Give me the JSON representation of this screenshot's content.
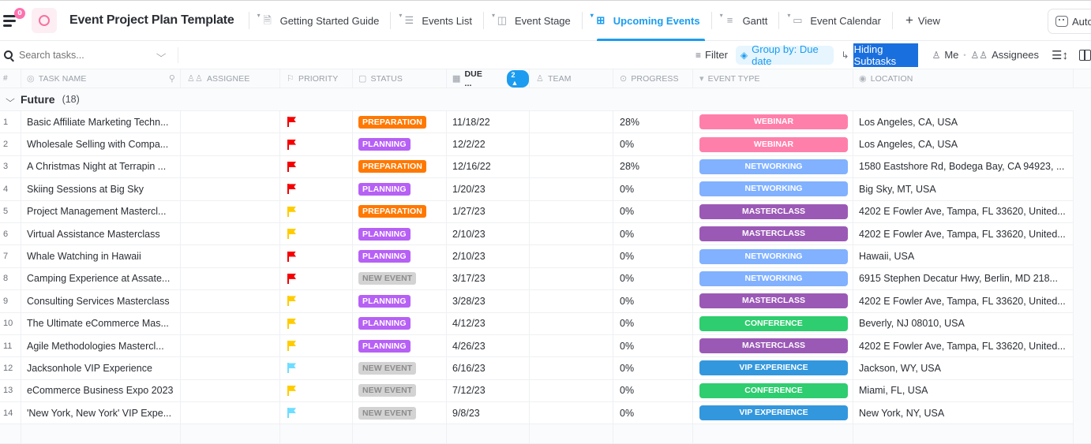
{
  "header": {
    "notification_count": "0",
    "title": "Event Project Plan Template",
    "tabs": [
      {
        "label": "Getting Started Guide",
        "icon": "doc-icon",
        "glyph": "🗎",
        "active": false
      },
      {
        "label": "Events List",
        "icon": "list-icon",
        "glyph": "☰",
        "active": false
      },
      {
        "label": "Event Stage",
        "icon": "board-icon",
        "glyph": "◫",
        "active": false
      },
      {
        "label": "Upcoming Events",
        "icon": "table-icon",
        "glyph": "⊞",
        "active": true
      },
      {
        "label": "Gantt",
        "icon": "gantt-icon",
        "glyph": "≡",
        "active": false
      },
      {
        "label": "Event Calendar",
        "icon": "calendar-icon",
        "glyph": "▭",
        "active": false
      }
    ],
    "add_view_label": "View",
    "automations_label": "Auto"
  },
  "toolbar": {
    "search_placeholder": "Search tasks...",
    "filter_label": "Filter",
    "group_by_label": "Group by: Due date",
    "subtasks_label": "Hiding Subtasks",
    "me_label": "Me",
    "assignees_label": "Assignees"
  },
  "columns": {
    "num": "#",
    "name": "TASK NAME",
    "assignee": "ASSIGNEE",
    "priority": "PRIORITY",
    "status": "STATUS",
    "due": "DUE ...",
    "due_sort_badge": "2 ▲",
    "team": "TEAM",
    "progress": "PROGRESS",
    "event_type": "EVENT TYPE",
    "location": "LOCATION"
  },
  "group": {
    "name": "Future",
    "count": "(18)"
  },
  "colors": {
    "priority": {
      "urgent": "#f50000",
      "high": "#ffcc00",
      "normal": "#6fddff"
    },
    "status": {
      "PREPARATION": "#ff7800",
      "PLANNING": "#b660f5",
      "NEW EVENT": "#d3d3d3"
    },
    "status_text": {
      "PREPARATION": "#ffffff",
      "PLANNING": "#ffffff",
      "NEW EVENT": "#8c8c8c"
    },
    "event_type": {
      "WEBINAR": "#ff7fab",
      "NETWORKING": "#81b1ff",
      "MASTERCLASS": "#9b59b6",
      "CONFERENCE": "#2ecd6f",
      "VIP EXPERIENCE": "#3397dd"
    },
    "accent": "#1b9cf0"
  },
  "rows": [
    {
      "num": "1",
      "name": "Basic Affiliate Marketing Techn...",
      "priority": "urgent",
      "status": "PREPARATION",
      "due": "11/18/22",
      "progress": "28%",
      "event_type": "WEBINAR",
      "location": "Los Angeles, CA, USA"
    },
    {
      "num": "2",
      "name": "Wholesale Selling with Compa...",
      "priority": "urgent",
      "status": "PLANNING",
      "due": "12/2/22",
      "progress": "0%",
      "event_type": "WEBINAR",
      "location": "Los Angeles, CA, USA"
    },
    {
      "num": "3",
      "name": "A Christmas Night at Terrapin ...",
      "priority": "urgent",
      "status": "PREPARATION",
      "due": "12/16/22",
      "progress": "28%",
      "event_type": "NETWORKING",
      "location": "1580 Eastshore Rd, Bodega Bay, CA 94923, ..."
    },
    {
      "num": "4",
      "name": "Skiing Sessions at Big Sky",
      "priority": "urgent",
      "status": "PLANNING",
      "due": "1/20/23",
      "progress": "0%",
      "event_type": "NETWORKING",
      "location": "Big Sky, MT, USA"
    },
    {
      "num": "5",
      "name": "Project Management Mastercl...",
      "priority": "high",
      "status": "PREPARATION",
      "due": "1/27/23",
      "progress": "0%",
      "event_type": "MASTERCLASS",
      "location": "4202 E Fowler Ave, Tampa, FL 33620, United..."
    },
    {
      "num": "6",
      "name": "Virtual Assistance Masterclass",
      "priority": "high",
      "status": "PLANNING",
      "due": "2/10/23",
      "progress": "0%",
      "event_type": "MASTERCLASS",
      "location": "4202 E Fowler Ave, Tampa, FL 33620, United..."
    },
    {
      "num": "7",
      "name": "Whale Watching in Hawaii",
      "priority": "urgent",
      "status": "PLANNING",
      "due": "2/10/23",
      "progress": "0%",
      "event_type": "NETWORKING",
      "location": "Hawaii, USA"
    },
    {
      "num": "8",
      "name": "Camping Experience at Assate...",
      "priority": "urgent",
      "status": "NEW EVENT",
      "due": "3/17/23",
      "progress": "0%",
      "event_type": "NETWORKING",
      "location": "6915 Stephen Decatur Hwy, Berlin, MD 218..."
    },
    {
      "num": "9",
      "name": "Consulting Services Masterclass",
      "priority": "high",
      "status": "PLANNING",
      "due": "3/28/23",
      "progress": "0%",
      "event_type": "MASTERCLASS",
      "location": "4202 E Fowler Ave, Tampa, FL 33620, United..."
    },
    {
      "num": "10",
      "name": "The Ultimate eCommerce Mas...",
      "priority": "high",
      "status": "PLANNING",
      "due": "4/12/23",
      "progress": "0%",
      "event_type": "CONFERENCE",
      "location": "Beverly, NJ 08010, USA"
    },
    {
      "num": "11",
      "name": "Agile Methodologies Mastercl...",
      "priority": "high",
      "status": "PLANNING",
      "due": "4/26/23",
      "progress": "0%",
      "event_type": "MASTERCLASS",
      "location": "4202 E Fowler Ave, Tampa, FL 33620, United..."
    },
    {
      "num": "12",
      "name": "Jacksonhole VIP Experience",
      "priority": "normal",
      "status": "NEW EVENT",
      "due": "6/16/23",
      "progress": "0%",
      "event_type": "VIP EXPERIENCE",
      "location": "Jackson, WY, USA"
    },
    {
      "num": "13",
      "name": "eCommerce Business Expo 2023",
      "priority": "high",
      "status": "NEW EVENT",
      "due": "7/12/23",
      "progress": "0%",
      "event_type": "CONFERENCE",
      "location": "Miami, FL, USA"
    },
    {
      "num": "14",
      "name": "'New York, New York' VIP Expe...",
      "priority": "normal",
      "status": "NEW EVENT",
      "due": "9/8/23",
      "progress": "0%",
      "event_type": "VIP EXPERIENCE",
      "location": "New York, NY, USA"
    }
  ]
}
